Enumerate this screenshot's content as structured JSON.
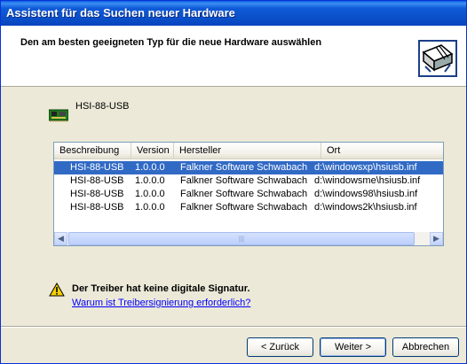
{
  "window": {
    "title": "Assistent für das Suchen neuer Hardware"
  },
  "header": {
    "title": "Den am besten geeigneten Typ für die neue Hardware auswählen",
    "icon": "hardware-wizard-icon"
  },
  "device": {
    "name": "HSI-88-USB",
    "icon": "circuit-board-icon"
  },
  "driver_list": {
    "columns": [
      "Beschreibung",
      "Version",
      "Hersteller",
      "Ort"
    ],
    "rows": [
      {
        "description": "HSI-88-USB",
        "version": "1.0.0.0",
        "manufacturer": "Falkner Software Schwabach",
        "location": "d:\\windowsxp\\hsiusb.inf",
        "selected": true
      },
      {
        "description": "HSI-88-USB",
        "version": "1.0.0.0",
        "manufacturer": "Falkner Software Schwabach",
        "location": "d:\\windowsme\\hsiusb.inf",
        "selected": false
      },
      {
        "description": "HSI-88-USB",
        "version": "1.0.0.0",
        "manufacturer": "Falkner Software Schwabach",
        "location": "d:\\windows98\\hsiusb.inf",
        "selected": false
      },
      {
        "description": "HSI-88-USB",
        "version": "1.0.0.0",
        "manufacturer": "Falkner Software Schwabach",
        "location": "d:\\windows2k\\hsiusb.inf",
        "selected": false
      }
    ]
  },
  "warning": {
    "icon": "warning-icon",
    "text": "Der Treiber hat keine digitale Signatur.",
    "link": "Warum ist Treibersignierung erforderlich?"
  },
  "buttons": {
    "back": "< Zurück",
    "next": "Weiter >",
    "cancel": "Abbrechen"
  },
  "colors": {
    "title_bar": "#0b4fc9",
    "selection": "#316ac5",
    "link": "#0000ff"
  }
}
